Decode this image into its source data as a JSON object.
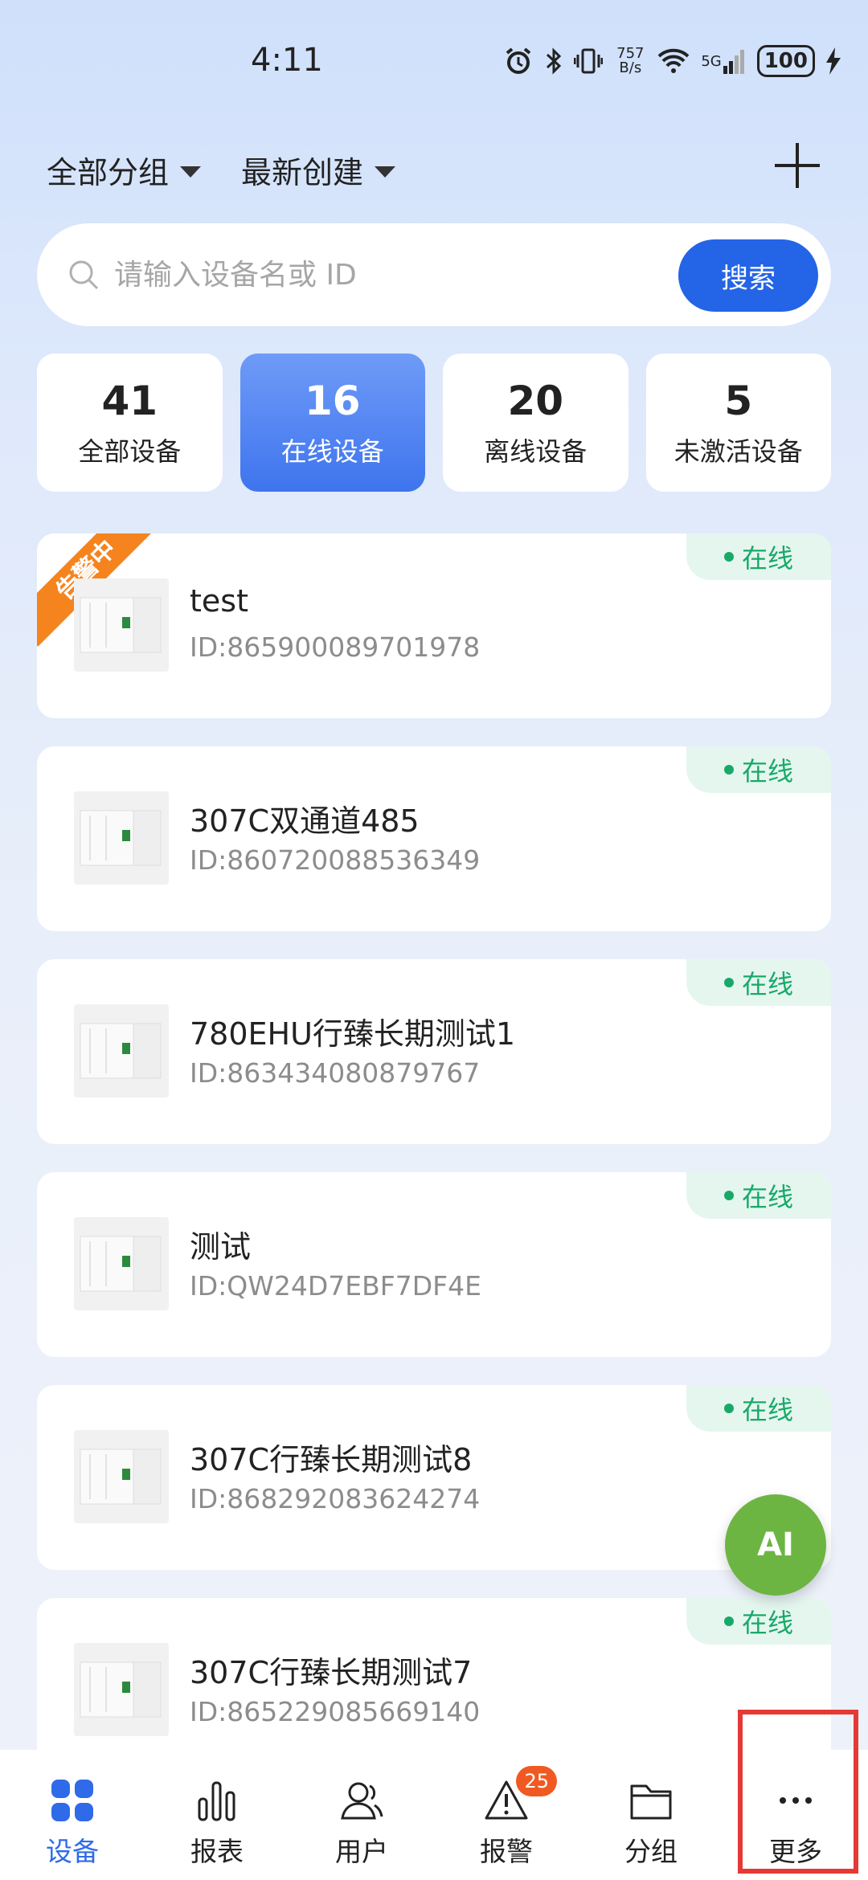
{
  "status_bar": {
    "time": "4:11",
    "net_speed_value": "757",
    "net_speed_unit": "B/s",
    "network": "5G",
    "battery": "100"
  },
  "header": {
    "group_filter": "全部分组",
    "sort_filter": "最新创建"
  },
  "search": {
    "placeholder": "请输入设备名或 ID",
    "button_label": "搜索"
  },
  "stats": [
    {
      "count": "41",
      "label": "全部设备"
    },
    {
      "count": "16",
      "label": "在线设备"
    },
    {
      "count": "20",
      "label": "离线设备"
    },
    {
      "count": "5",
      "label": "未激活设备"
    }
  ],
  "devices": [
    {
      "name": "test",
      "id": "ID:865900089701978",
      "status": "在线",
      "ribbon": "告警中"
    },
    {
      "name": "307C双通道485",
      "id": "ID:860720088536349",
      "status": "在线"
    },
    {
      "name": "780EHU行臻长期测试1",
      "id": "ID:863434080879767",
      "status": "在线"
    },
    {
      "name": "测试",
      "id": "ID:QW24D7EBF7DF4E",
      "status": "在线"
    },
    {
      "name": "307C行臻长期测试8",
      "id": "ID:868292083624274",
      "status": "在线"
    },
    {
      "name": "307C行臻长期测试7",
      "id": "ID:865229085669140",
      "status": "在线"
    }
  ],
  "ai_button": "AI",
  "nav": {
    "items": [
      {
        "label": "设备",
        "icon": "grid-icon"
      },
      {
        "label": "报表",
        "icon": "bar-chart-icon"
      },
      {
        "label": "用户",
        "icon": "user-icon"
      },
      {
        "label": "报警",
        "icon": "warning-icon",
        "badge": "25"
      },
      {
        "label": "分组",
        "icon": "folder-icon"
      },
      {
        "label": "更多",
        "icon": "more-icon"
      }
    ]
  },
  "colors": {
    "accent": "#2464e6",
    "online": "#18a968",
    "alarm": "#f5841f",
    "ai": "#6db543",
    "highlight": "#e53935"
  }
}
